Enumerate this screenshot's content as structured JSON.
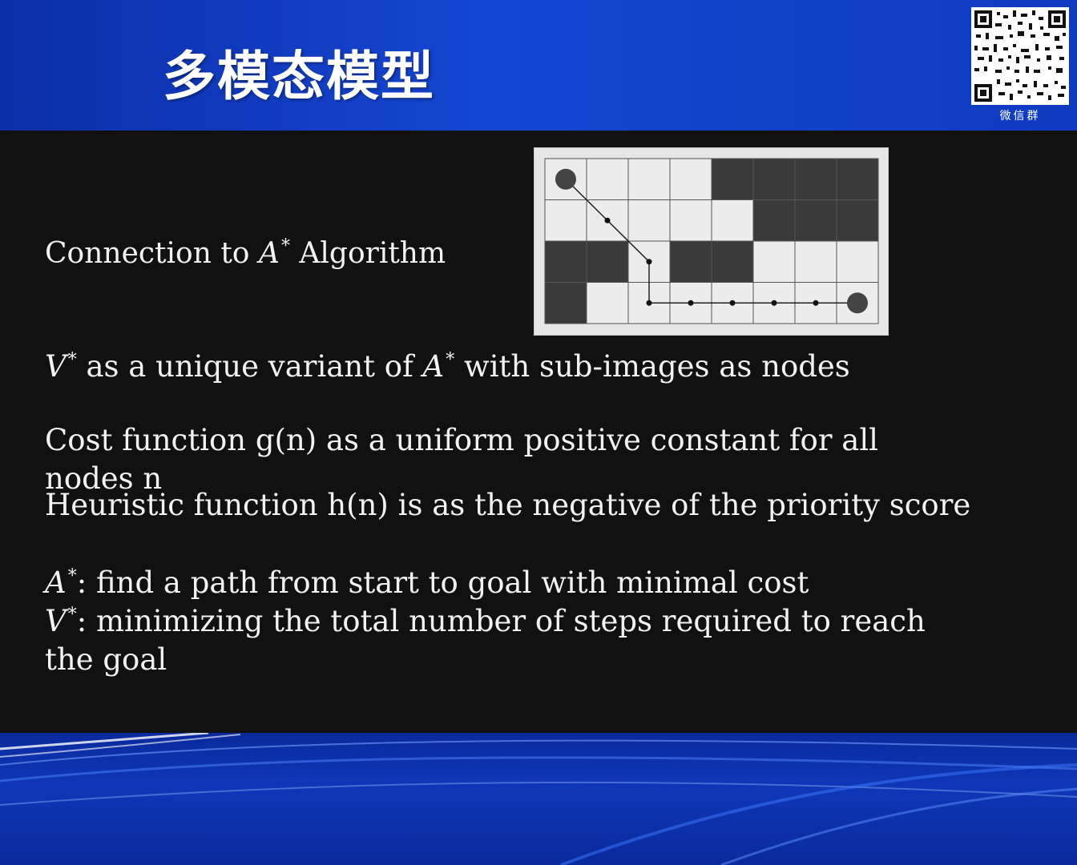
{
  "header": {
    "title": "多模态模型",
    "qr_caption": "微信群"
  },
  "slide": {
    "heading": {
      "pre": "Connection to ",
      "var": "A",
      "sup": "*",
      "post": " Algorithm"
    },
    "line1": {
      "var1": "V",
      "sup1": "*",
      "mid": " as a unique variant of ",
      "var2": "A",
      "sup2": "*",
      "post": " with sub-images as nodes"
    },
    "line2a": "Cost function g(n) as a uniform positive constant for all",
    "line2b": "nodes n",
    "line3": "Heuristic function h(n) is as the negative of the priority score",
    "line4": {
      "var": "A",
      "sup": "*",
      "text": ": find a path from start to goal with minimal cost"
    },
    "line5": {
      "var": "V",
      "sup": "*",
      "text": ": minimizing the total number of steps required to reach"
    },
    "line6": "the goal"
  },
  "grid_figure": {
    "rows": 4,
    "cols": 8,
    "dark_cells": [
      [
        0,
        4
      ],
      [
        0,
        5
      ],
      [
        0,
        6
      ],
      [
        0,
        7
      ],
      [
        1,
        5
      ],
      [
        1,
        6
      ],
      [
        1,
        7
      ],
      [
        2,
        0
      ],
      [
        2,
        1
      ],
      [
        2,
        3
      ],
      [
        2,
        4
      ],
      [
        3,
        0
      ]
    ],
    "start_cell": [
      0,
      0
    ],
    "goal_cell": [
      3,
      7
    ],
    "path_cells": [
      [
        0,
        0
      ],
      [
        1,
        1
      ],
      [
        2,
        2
      ],
      [
        3,
        2
      ],
      [
        3,
        3
      ],
      [
        3,
        4
      ],
      [
        3,
        5
      ],
      [
        3,
        6
      ],
      [
        3,
        7
      ]
    ],
    "colors": {
      "light": "#ececec",
      "dark": "#3a3a3a",
      "line": "#222222"
    }
  }
}
